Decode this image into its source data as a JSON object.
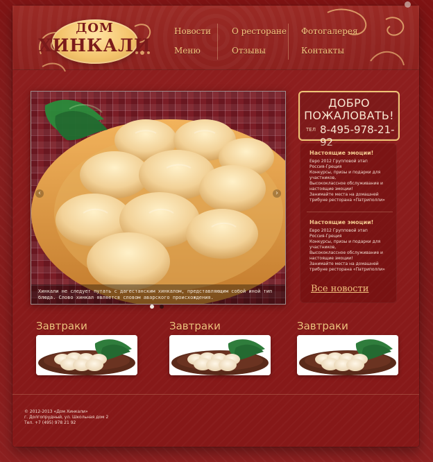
{
  "header": {
    "logo": {
      "line1": "ДОМ",
      "line2": "ХИНКАЛИ"
    },
    "nav": [
      {
        "label": "Новости"
      },
      {
        "label": "Меню"
      },
      {
        "label": "О ресторане"
      },
      {
        "label": "Отзывы"
      },
      {
        "label": "Фотогалерея"
      },
      {
        "label": "Контакты"
      }
    ]
  },
  "slider": {
    "caption": "Хинкали не следует путать с дагестанским хинкалом, представляющим собой иной тип блюда. Слово хинкал является словом аварского происхождения.",
    "prev_symbol": "‹",
    "next_symbol": "›"
  },
  "welcome": {
    "line1": "ДОБРО",
    "line2": "ПОЖАЛОВАТЬ!",
    "phone_label": "ТЕЛ",
    "phone": "8-495-978-21-92"
  },
  "news": {
    "items": [
      {
        "title": "Настоящие эмоции!",
        "body": "Евро 2012 Групповой этап\nРоссия-Греция\nКонкурсы, призы и подарки для участников,\nВысококлассное обслуживание и настоящие эмоции!\nЗанимайте места на домашней трибуне ресторана «Патриполли»"
      },
      {
        "title": "Настоящие эмоции!",
        "body": "Евро 2012 Групповой этап\nРоссия-Греция\nКонкурсы, призы и подарки для участников,\nВысококлассное обслуживание и настоящие эмоции!\nЗанимайте места на домашней трибуне ресторана «Патриполли»"
      }
    ],
    "all_link": "Все новости"
  },
  "cards": [
    {
      "title": "Завтраки"
    },
    {
      "title": "Завтраки"
    },
    {
      "title": "Завтраки"
    }
  ],
  "footer": {
    "line1": "© 2012-2013 «Дом Хинкали»",
    "line2": "г. Долгопрудный, ул. Школьная дом 2",
    "line3": "Тел. +7 (495) 978 21 92"
  },
  "colors": {
    "bg": "#8a1b1b",
    "accent": "#f2c27e",
    "cream": "#f8e6d1",
    "logo_oval": "#f4c56e"
  }
}
